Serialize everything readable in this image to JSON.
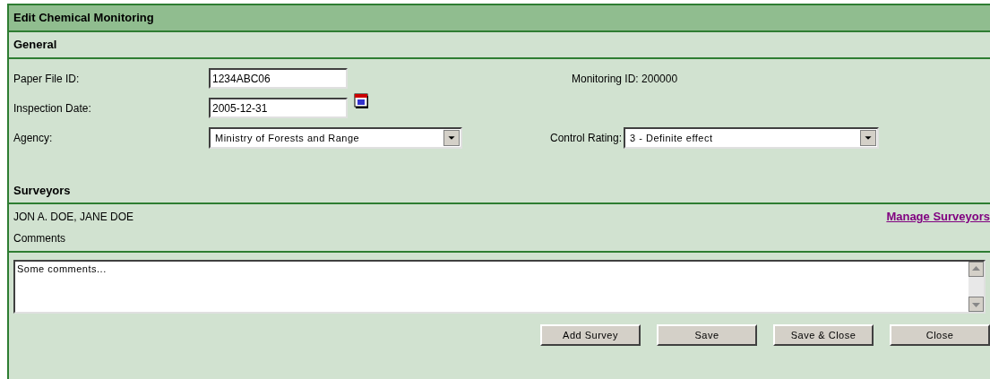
{
  "title": "Edit Chemical Monitoring",
  "general": {
    "heading": "General",
    "paper_file_id": {
      "label": "Paper File ID:",
      "value": "1234ABC06"
    },
    "monitoring_id": "Monitoring ID: 200000",
    "inspection_date": {
      "label": "Inspection Date:",
      "value": "2005-12-31"
    },
    "agency": {
      "label": "Agency:",
      "value": "Ministry of Forests and Range"
    },
    "control_rating": {
      "label": "Control Rating:",
      "value": "3 - Definite effect"
    }
  },
  "surveyors": {
    "heading": "Surveyors",
    "names": "JON A. DOE, JANE DOE",
    "link": "Manage Surveyors",
    "comments_label": "Comments",
    "comments": "Some comments..."
  },
  "buttons": [
    "Add Survey",
    "Save",
    "Save & Close",
    "Close"
  ]
}
